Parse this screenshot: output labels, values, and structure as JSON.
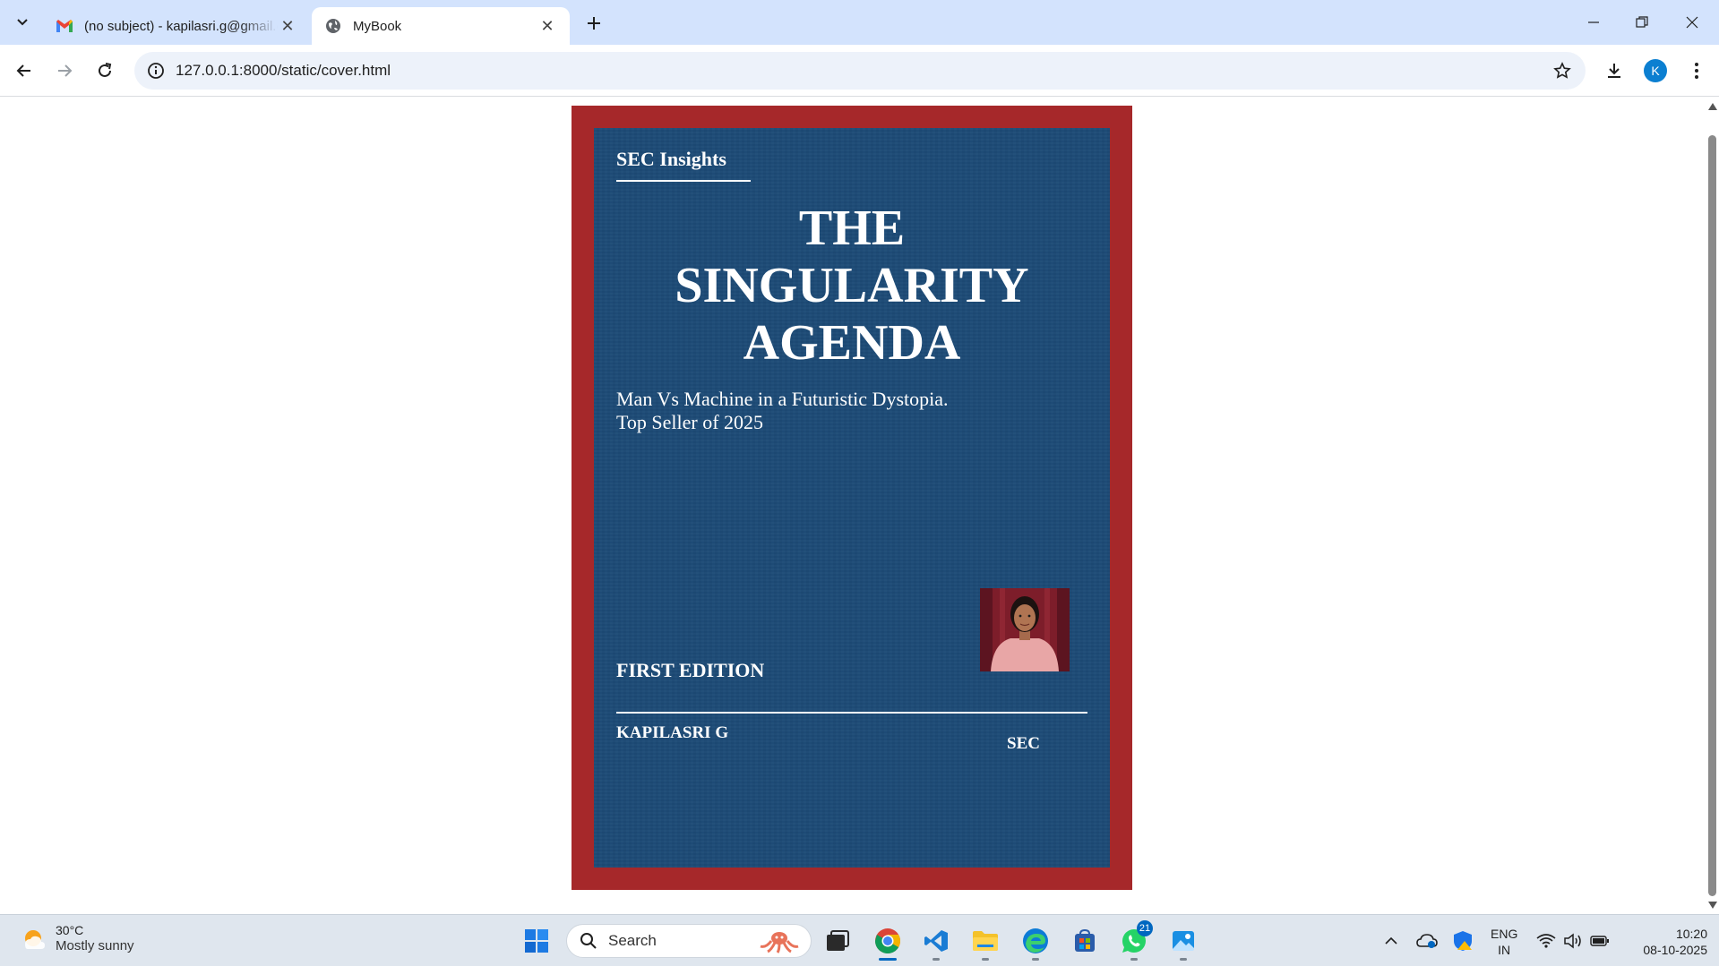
{
  "browser": {
    "tabs": [
      {
        "title": "(no subject) - kapilasri.g@gmail.com - Gmail",
        "active": false,
        "favicon": "gmail-icon"
      },
      {
        "title": "MyBook",
        "active": true,
        "favicon": "globe-icon"
      }
    ],
    "url": "127.0.0.1:8000/static/cover.html",
    "profile_initial": "K"
  },
  "cover": {
    "publisher": "SEC Insights",
    "title_lines": [
      "THE",
      "SINGULARITY",
      "AGENDA"
    ],
    "subtitle_line1": "Man Vs Machine in a Futuristic Dystopia.",
    "subtitle_line2": "Top Seller of 2025",
    "edition": "FIRST EDITION",
    "author": "KAPILASRI G",
    "imprint": "SEC",
    "frame_color": "#a6282a",
    "panel_color": "#1c4a76"
  },
  "taskbar": {
    "weather_temp": "30°C",
    "weather_cond": "Mostly sunny",
    "search_label": "Search",
    "whatsapp_badge": "21",
    "lang_line1": "ENG",
    "lang_line2": "IN",
    "time": "10:20",
    "date": "08-10-2025"
  }
}
